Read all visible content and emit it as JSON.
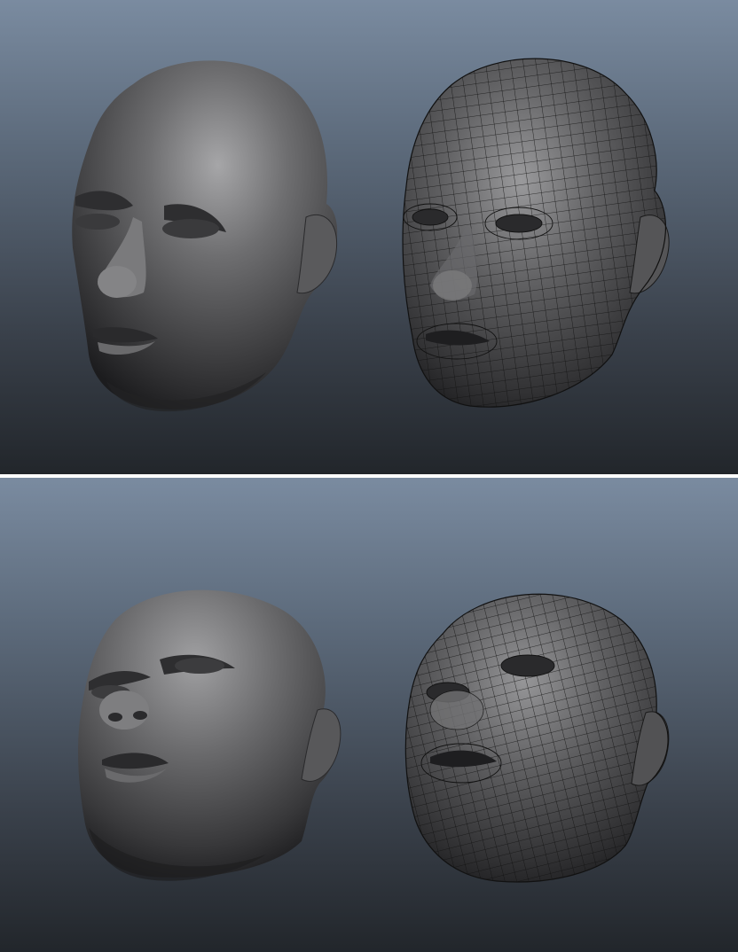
{
  "app": {
    "description_visible": false
  },
  "viewports": [
    {
      "view": "top",
      "models": [
        {
          "shading": "smooth",
          "wireframe_overlay": false,
          "icon": "head-model"
        },
        {
          "shading": "smooth",
          "wireframe_overlay": true,
          "icon": "head-model-wireframe"
        }
      ]
    },
    {
      "view": "bottom",
      "models": [
        {
          "shading": "smooth",
          "wireframe_overlay": false,
          "icon": "head-model"
        },
        {
          "shading": "smooth",
          "wireframe_overlay": true,
          "icon": "head-model-wireframe"
        }
      ]
    }
  ],
  "colors": {
    "background_top": "#7a8ba0",
    "background_bottom": "#22262b",
    "model_base": "#4d4d4f",
    "model_highlight": "#9a9a9c",
    "wire": "#111111",
    "divider": "#ffffff"
  }
}
